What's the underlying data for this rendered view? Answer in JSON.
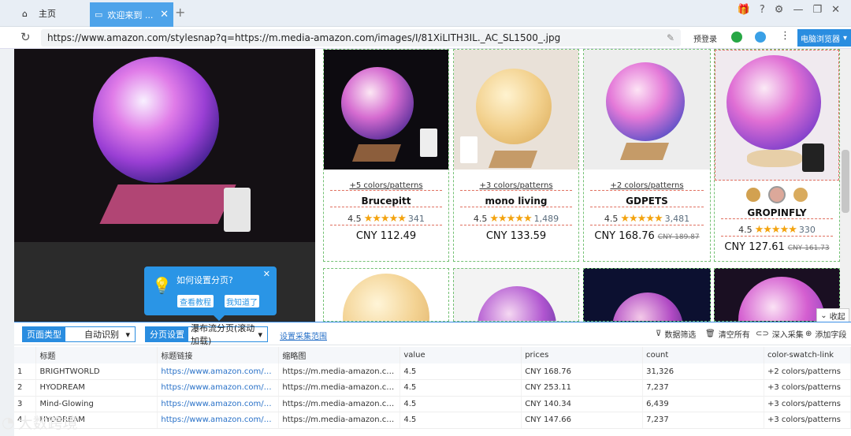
{
  "browser": {
    "home_tab_label": "主页",
    "active_tab_label": "欢迎来到 ...",
    "new_tab_symbol": "+",
    "url": "https://www.amazon.com/stylesnap?q=https://m.media-amazon.com/images/I/81XiLITH3IL._AC_SL1500_.jpg",
    "login_label": "预登录",
    "mode_label": "电脑浏览器"
  },
  "products": [
    {
      "colors": "+5 colors/patterns",
      "name": "Brucepitt",
      "rating": "4.5",
      "stars": "★★★★★",
      "count": "341",
      "price": "CNY 112.49",
      "old_price": ""
    },
    {
      "colors": "+3 colors/patterns",
      "name": "mono living",
      "rating": "4.5",
      "stars": "★★★★★",
      "count": "1,489",
      "price": "CNY 133.59",
      "old_price": ""
    },
    {
      "colors": "+2 colors/patterns",
      "name": "GDPETS",
      "rating": "4.5",
      "stars": "★★★★★",
      "count": "3,481",
      "price": "CNY 168.76",
      "old_price": "CNY 189.87"
    },
    {
      "colors": "",
      "name": "GROPINFLY",
      "rating": "4.5",
      "stars": "★★★★★",
      "count": "330",
      "price": "CNY 127.61",
      "old_price": "CNY 161.73"
    }
  ],
  "tooltip": {
    "title": "如何设置分页?",
    "btn_tutorial": "查看教程",
    "btn_know": "我知道了"
  },
  "toolbar": {
    "page_type_label": "页面类型",
    "page_type_value": "自动识别",
    "paging_label": "分页设置",
    "paging_value": "瀑布流分页(滚动加载)",
    "range_link": "设置采集范围",
    "filter": "数据筛选",
    "clear": "清空所有",
    "deep": "深入采集",
    "add_field": "添加字段",
    "collapse": "收起"
  },
  "table": {
    "headers": [
      "",
      "标题",
      "标题链接",
      "缩略图",
      "value",
      "prices",
      "count",
      "color-swatch-link"
    ],
    "rows": [
      [
        "1",
        "BRIGHTWORLD",
        "https://www.amazon.com/dp/B07...",
        "https://m.media-amazon.com/ima...",
        "4.5",
        "CNY 168.76",
        "31,326",
        "+2 colors/patterns"
      ],
      [
        "2",
        "HYODREAM",
        "https://www.amazon.com/dp/B08...",
        "https://m.media-amazon.com/ima...",
        "4.5",
        "CNY 253.11",
        "7,237",
        "+3 colors/patterns"
      ],
      [
        "3",
        "Mind-Glowing",
        "https://www.amazon.com/dp/B08...",
        "https://m.media-amazon.com/ima...",
        "4.5",
        "CNY 140.34",
        "6,439",
        "+3 colors/patterns"
      ],
      [
        "4",
        "HYODREAM",
        "https://www.amazon.com/dp/B07...",
        "https://m.media-amazon.com/ima...",
        "4.5",
        "CNY 147.66",
        "7,237",
        "+3 colors/patterns"
      ]
    ]
  },
  "watermark": "大数跨境"
}
